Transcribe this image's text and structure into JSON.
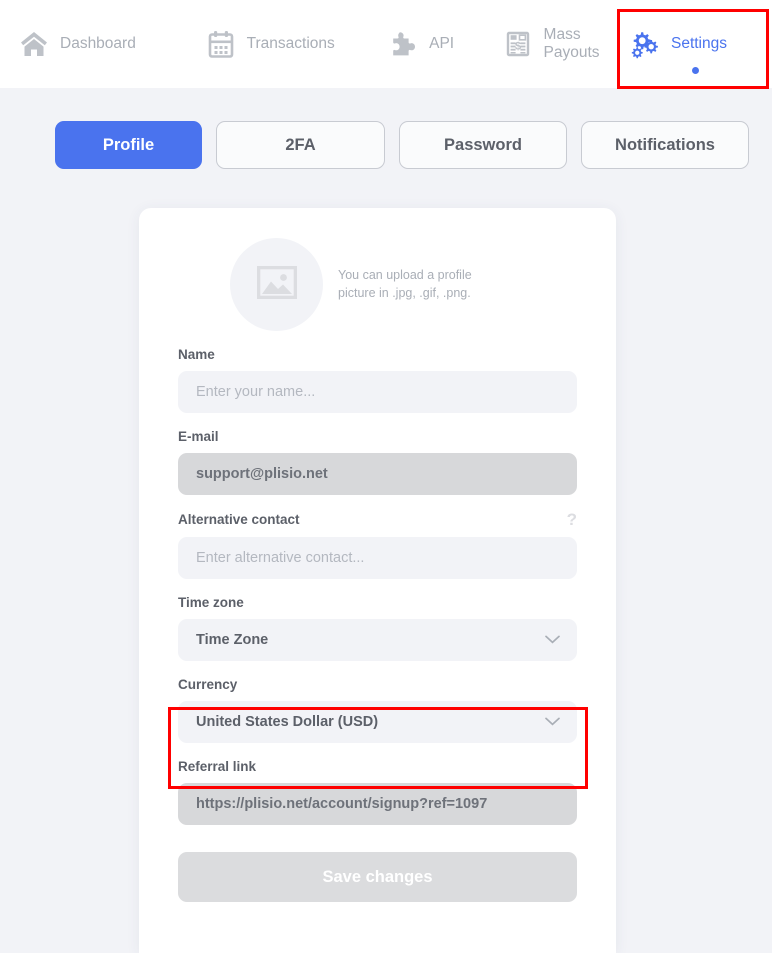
{
  "nav": {
    "items": [
      {
        "label": "Dashboard",
        "icon": "home-icon",
        "active": false
      },
      {
        "label": "Transactions",
        "icon": "calendar-icon",
        "active": false
      },
      {
        "label": "API",
        "icon": "puzzle-icon",
        "active": false
      },
      {
        "label": "Mass Payouts",
        "icon": "invoice-icon",
        "active": false
      },
      {
        "label": "Settings",
        "icon": "gears-icon",
        "active": true
      }
    ]
  },
  "tabs": [
    {
      "label": "Profile",
      "active": true
    },
    {
      "label": "2FA",
      "active": false
    },
    {
      "label": "Password",
      "active": false
    },
    {
      "label": "Notifications",
      "active": false
    }
  ],
  "avatar": {
    "note": "You can upload a profile picture in .jpg, .gif, .png."
  },
  "form": {
    "name": {
      "label": "Name",
      "placeholder": "Enter your name...",
      "value": ""
    },
    "email": {
      "label": "E-mail",
      "value": "support@plisio.net"
    },
    "alt_contact": {
      "label": "Alternative contact",
      "help": "?",
      "placeholder": "Enter alternative contact...",
      "value": ""
    },
    "timezone": {
      "label": "Time zone",
      "value": "Time Zone"
    },
    "currency": {
      "label": "Currency",
      "value": "United States Dollar (USD)"
    },
    "referral": {
      "label": "Referral link",
      "value": "https://plisio.net/account/signup?ref=1097"
    },
    "save_label": "Save changes"
  },
  "colors": {
    "accent": "#4A73EE",
    "annotation": "#FF0000",
    "page_bg": "#F2F3F7",
    "input_bg": "#F2F3F7",
    "disabled_bg": "#D7D8DA",
    "muted_text": "#A9AEB6"
  }
}
